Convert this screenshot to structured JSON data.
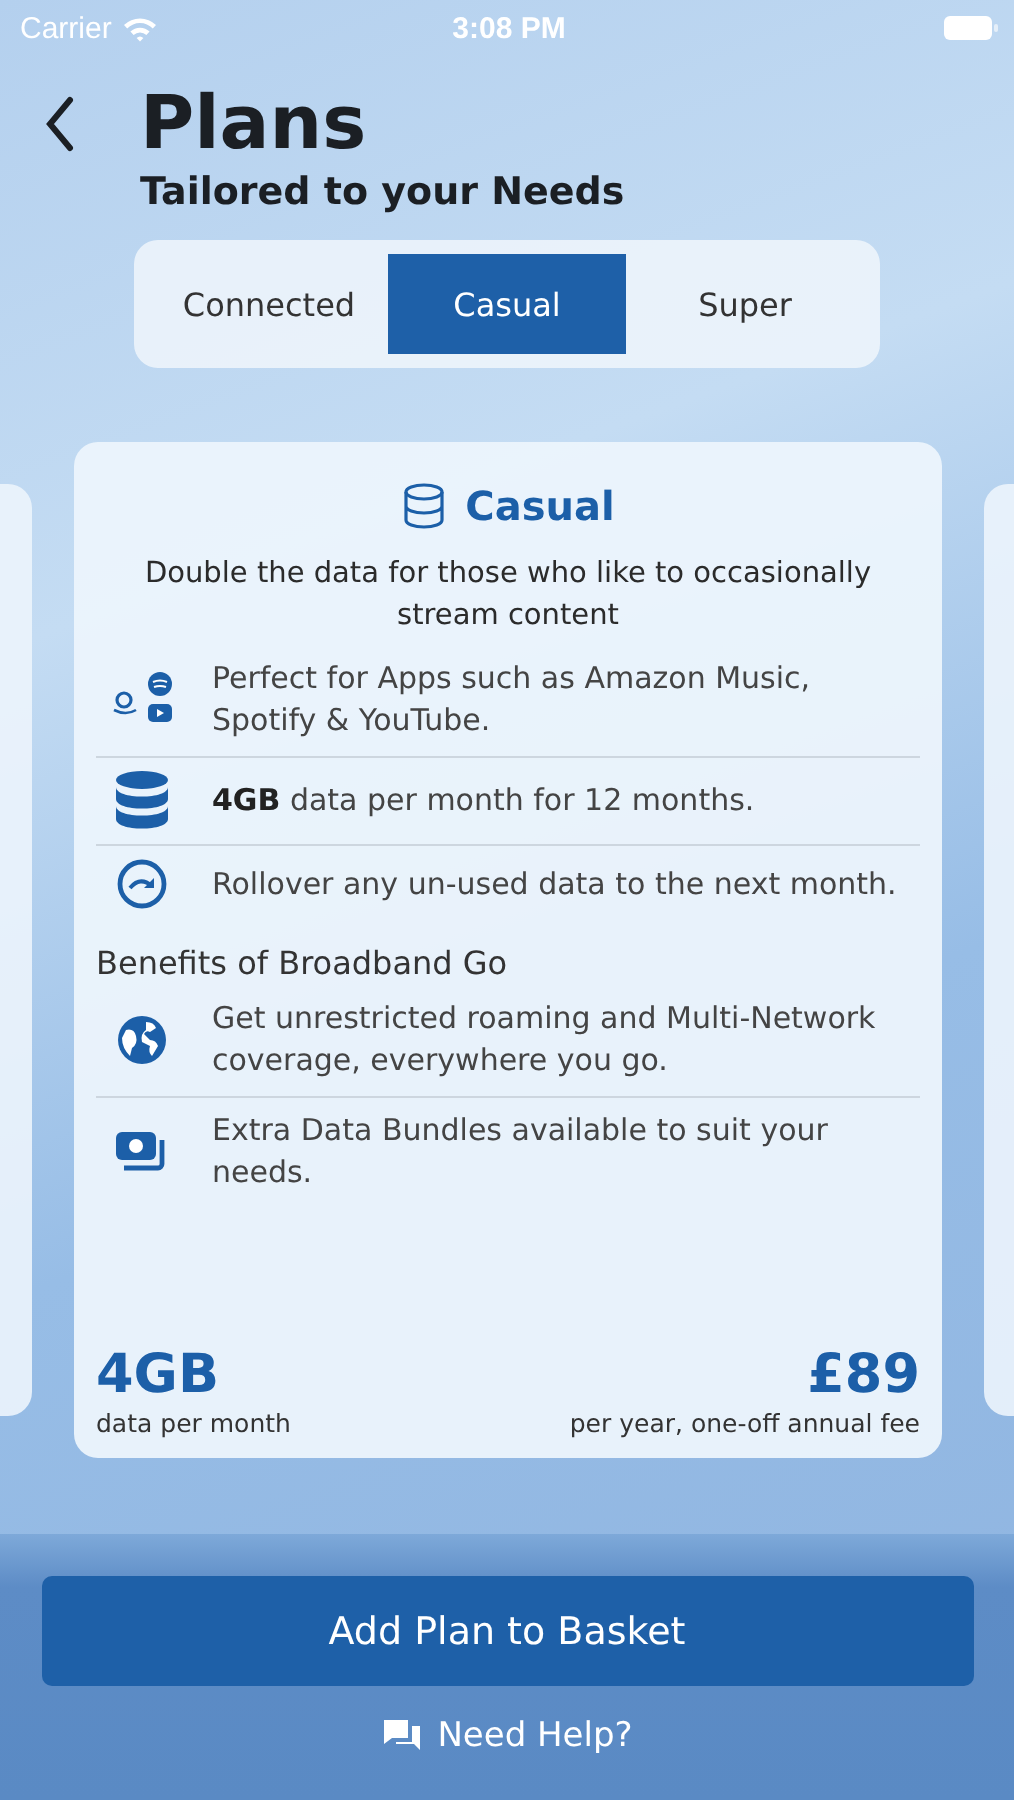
{
  "status_bar": {
    "carrier": "Carrier",
    "time": "3:08 PM"
  },
  "header": {
    "title": "Plans",
    "subtitle": "Tailored to your Needs"
  },
  "tabs": [
    {
      "label": "Connected",
      "selected": false
    },
    {
      "label": "Casual",
      "selected": true
    },
    {
      "label": "Super",
      "selected": false
    }
  ],
  "plan": {
    "name": "Casual",
    "description": "Double the data for those who like to occasionally stream content",
    "features": [
      {
        "kind": "apps",
        "text": "Perfect for Apps such as Amazon Music, Spotify & YouTube."
      },
      {
        "kind": "database",
        "text": "**4GB** data per month for 12 months."
      },
      {
        "kind": "rollover",
        "text": "Rollover any un-used data to the next month."
      }
    ],
    "benefits_title": "Benefits of Broadband Go",
    "benefits": [
      {
        "kind": "globe",
        "text": "Get unrestricted roaming and Multi-Network coverage, everywhere you go."
      },
      {
        "kind": "bundles",
        "text": "Extra Data Bundles available to suit your needs."
      }
    ],
    "data_amount": "4GB",
    "data_caption": "data per month",
    "price": "£89",
    "price_caption": "per year, one-off annual fee"
  },
  "add_button": "Add Plan to Basket",
  "help_link": "Need Help?"
}
